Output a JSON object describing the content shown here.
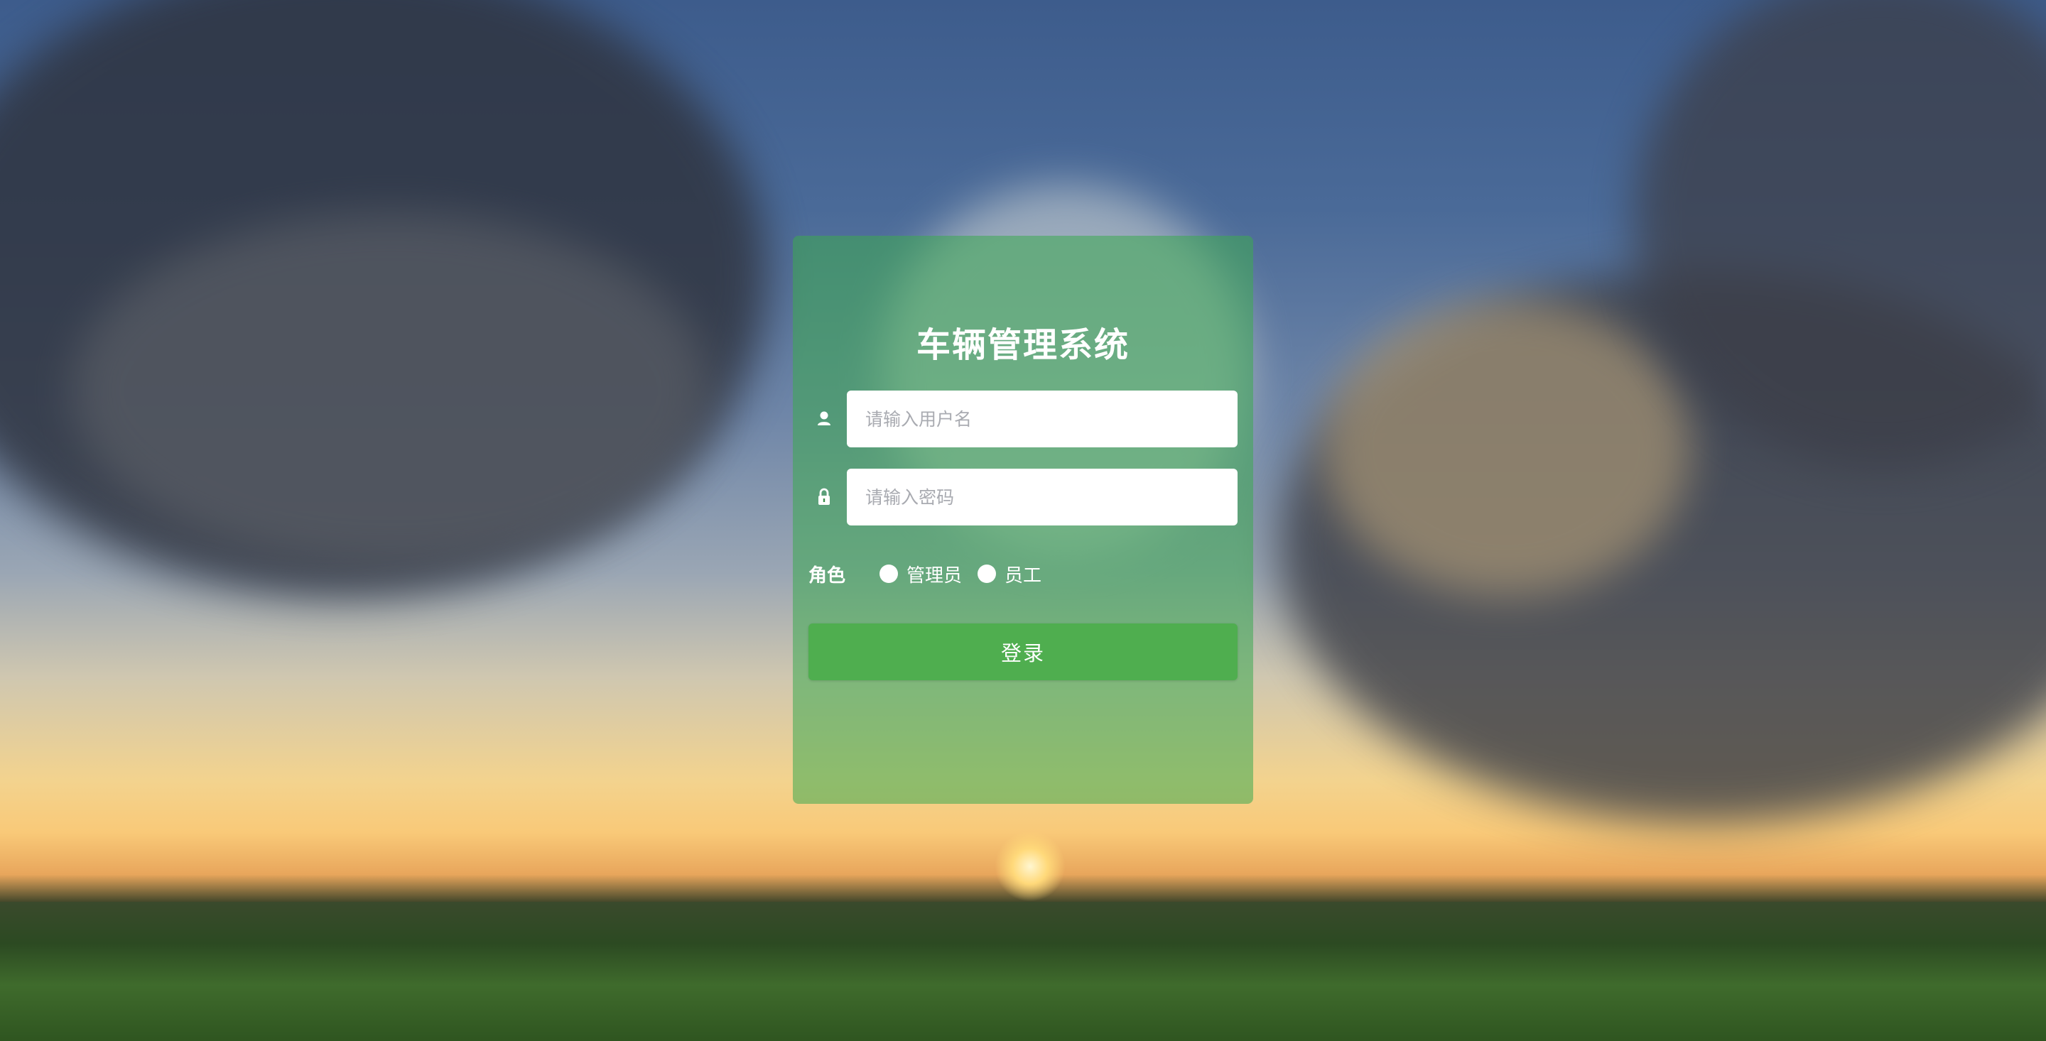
{
  "login": {
    "title": "车辆管理系统",
    "username": {
      "placeholder": "请输入用户名",
      "value": "",
      "icon": "user-icon"
    },
    "password": {
      "placeholder": "请输入密码",
      "value": "",
      "icon": "lock-icon"
    },
    "role": {
      "label": "角色",
      "options": [
        {
          "label": "管理员",
          "selected": false
        },
        {
          "label": "员工",
          "selected": false
        }
      ]
    },
    "submit_label": "登录"
  },
  "colors": {
    "panel": "#3caa50",
    "button": "#4fae4f",
    "text": "#ffffff"
  }
}
